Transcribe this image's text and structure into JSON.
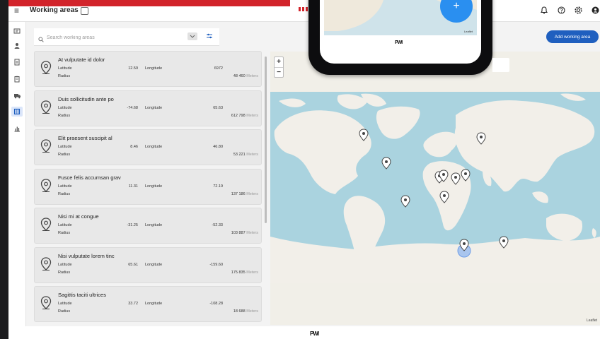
{
  "header": {
    "title": "Working areas",
    "icons": [
      "bell-icon",
      "help-icon",
      "settings-icon",
      "account-icon"
    ]
  },
  "sidebar": {
    "items": [
      "dashboard-icon",
      "person-icon",
      "document-icon",
      "clipboard-icon",
      "truck-icon",
      "map-icon",
      "chart-icon"
    ],
    "active_index": 5
  },
  "search": {
    "placeholder": "Search working areas"
  },
  "actions": {
    "add_label": "Add working area"
  },
  "labels": {
    "latitude": "Latitude",
    "longitude": "Longitude",
    "radius": "Radius",
    "unit": "Meters"
  },
  "areas": [
    {
      "name": "At vulputate id dolor",
      "latitude": "12.59",
      "longitude": "6972",
      "radius": "48 460"
    },
    {
      "name": "Duis sollicitudin ante po",
      "latitude": "-74.68",
      "longitude": "65.63",
      "radius": "612 798"
    },
    {
      "name": "Elit praesent suscipit al",
      "latitude": "8.46",
      "longitude": "46.80",
      "radius": "53 221"
    },
    {
      "name": "Fusce felis accumsan grav",
      "latitude": "11.31",
      "longitude": "72.19",
      "radius": "137 186"
    },
    {
      "name": "Nisi mi at congue",
      "latitude": "-31.25",
      "longitude": "-52.33",
      "radius": "103 887"
    },
    {
      "name": "Nisi vulputate lorem tinc",
      "latitude": "65.61",
      "longitude": "-159.60",
      "radius": "175 835"
    },
    {
      "name": "Sagittis taciti ultrices",
      "latitude": "33.72",
      "longitude": "-108.28",
      "radius": "18 688"
    }
  ],
  "map": {
    "attribution": "Leaflet",
    "zoom_in": "+",
    "zoom_out": "−",
    "ocean_color": "#aad3df",
    "land_color": "#f2efe9"
  },
  "phone": {
    "fab_label": "+",
    "attribution": "Leaflet",
    "logo": "PWI"
  },
  "footer": {
    "logo": "PWI"
  },
  "colors": {
    "primary": "#1f5fbf",
    "brand_red": "#d2232a"
  }
}
